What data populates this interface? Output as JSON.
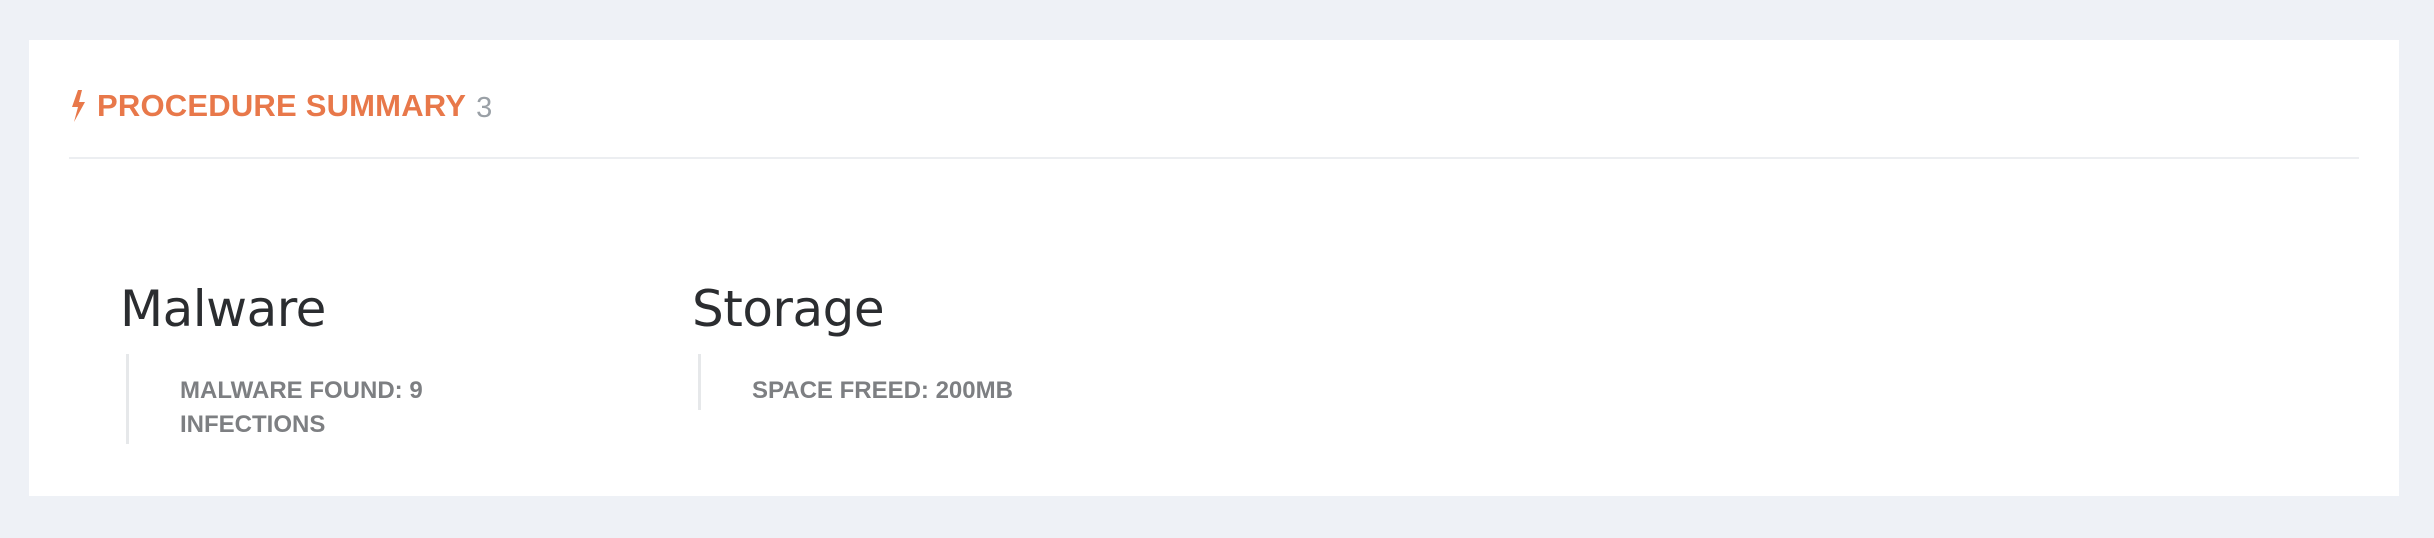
{
  "header": {
    "icon": "bolt-icon",
    "title": "PROCEDURE SUMMARY",
    "count": "3",
    "accent_color": "#e8784a"
  },
  "sections": [
    {
      "title": "Malware",
      "stat": "MALWARE FOUND: 9 INFECTIONS"
    },
    {
      "title": "Storage",
      "stat": "SPACE FREED: 200MB"
    }
  ]
}
